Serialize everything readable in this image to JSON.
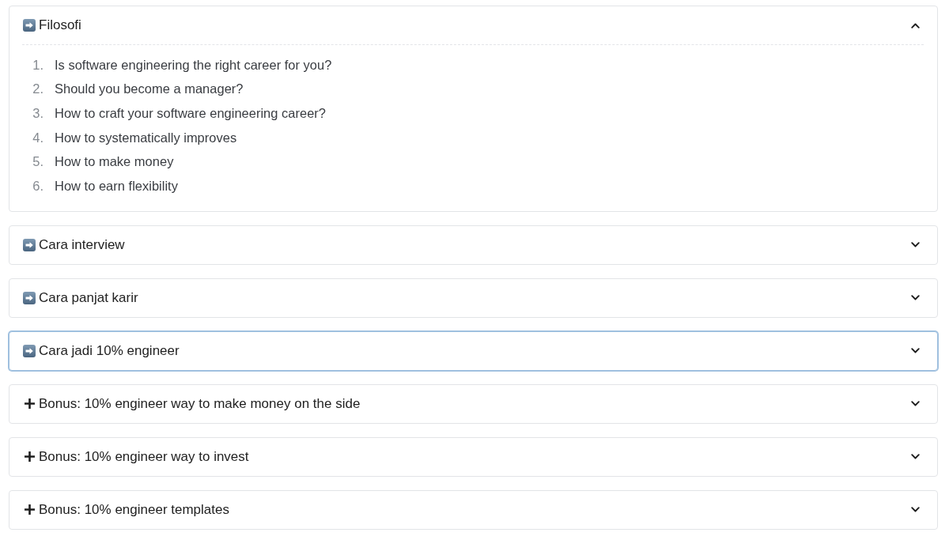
{
  "accordion": [
    {
      "kind": "chapter",
      "title": "Filosofi",
      "expanded": true,
      "focused": false,
      "items": [
        {
          "number": "1.",
          "text": "Is software engineering the right career for you?"
        },
        {
          "number": "2.",
          "text": "Should you become a manager?"
        },
        {
          "number": "3.",
          "text": "How to craft your software engineering career?"
        },
        {
          "number": "4.",
          "text": "How to systematically improves"
        },
        {
          "number": "5.",
          "text": "How to make money"
        },
        {
          "number": "6.",
          "text": "How to earn flexibility"
        }
      ]
    },
    {
      "kind": "chapter",
      "title": "Cara interview",
      "expanded": false,
      "focused": false
    },
    {
      "kind": "chapter",
      "title": "Cara panjat karir",
      "expanded": false,
      "focused": false
    },
    {
      "kind": "chapter",
      "title": "Cara jadi 10% engineer",
      "expanded": false,
      "focused": true
    },
    {
      "kind": "bonus",
      "title": "Bonus: 10% engineer way to make money on the side",
      "expanded": false,
      "focused": false
    },
    {
      "kind": "bonus",
      "title": "Bonus: 10% engineer way to invest",
      "expanded": false,
      "focused": false
    },
    {
      "kind": "bonus",
      "title": "Bonus: 10% engineer templates",
      "expanded": false,
      "focused": false
    }
  ]
}
